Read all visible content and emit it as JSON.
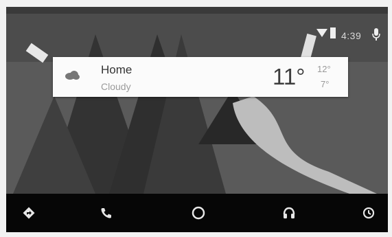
{
  "status_bar": {
    "time": "4:39",
    "icons": [
      "wifi-icon",
      "signal-icon",
      "mic-icon"
    ]
  },
  "weather_card": {
    "location": "Home",
    "condition": "Cloudy",
    "temperature": "11°",
    "high": "12°",
    "low": "7°",
    "icon": "cloud-icon"
  },
  "nav_bar": {
    "items": [
      {
        "name": "navigation",
        "icon": "directions-icon"
      },
      {
        "name": "phone",
        "icon": "phone-icon"
      },
      {
        "name": "home",
        "icon": "home-circle-icon"
      },
      {
        "name": "audio",
        "icon": "headphones-icon"
      },
      {
        "name": "system",
        "icon": "clock-back-icon"
      }
    ]
  },
  "colors": {
    "card_bg": "#fbfbfb",
    "nav_bg": "#060606",
    "accent_road": "#bdbdbd"
  }
}
